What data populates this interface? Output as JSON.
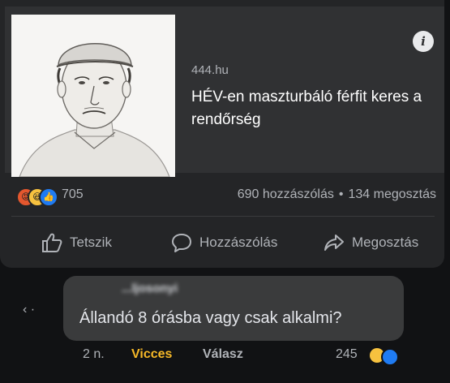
{
  "post": {
    "link": {
      "domain": "444.hu",
      "title": "HÉV-en maszturbáló férfit keres a rendőrség",
      "info_icon": "info-icon"
    },
    "reactions": {
      "icons": [
        "angry-reaction-icon",
        "haha-reaction-icon",
        "like-reaction-icon"
      ],
      "count": "705"
    },
    "stats": {
      "comments": "690 hozzászólás",
      "separator": "•",
      "shares": "134 megosztás"
    },
    "actions": {
      "like_label": "Tetszik",
      "comment_label": "Hozzászólás",
      "share_label": "Megosztás"
    }
  },
  "comment": {
    "author": "...ljosonyi",
    "text": "Állandó 8 órásba vagy csak alkalmi?",
    "time": "2 n.",
    "reaction_label": "Vicces",
    "reply_label": "Válasz",
    "reaction_count": "245",
    "thread_mark": "‹ ·"
  },
  "colors": {
    "background": "#111214",
    "card": "#242527",
    "bubble": "#3a3b3c",
    "like_blue": "#1f7bf2",
    "haha_yellow": "#f7c23f",
    "vicces": "#f7b928"
  }
}
